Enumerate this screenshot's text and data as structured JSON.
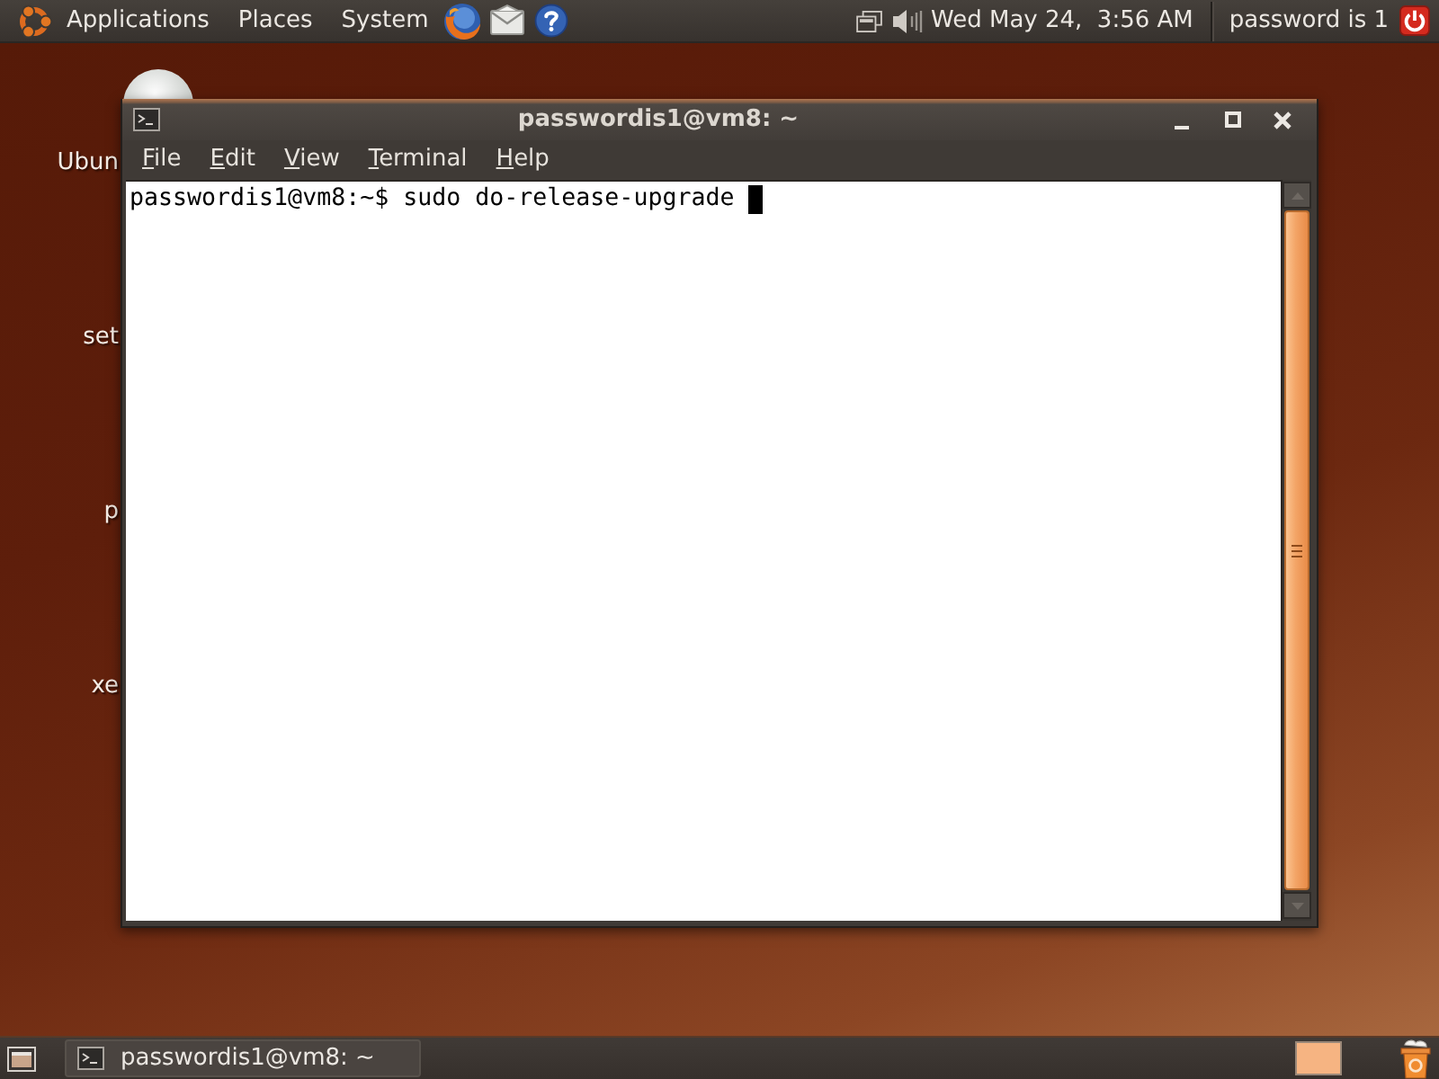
{
  "top_panel": {
    "menus": [
      "Applications",
      "Places",
      "System"
    ],
    "clock": "Wed May 24,  3:56 AM",
    "user": "password is 1"
  },
  "desktop_icons": [
    "Ubun",
    "set",
    "p",
    "xe"
  ],
  "window": {
    "title": "passwordis1@vm8: ~",
    "menu": [
      {
        "label": "File",
        "mnemonic_underlined": true
      },
      {
        "label": "Edit",
        "mnemonic_underlined": true
      },
      {
        "label": "View",
        "mnemonic_underlined": true
      },
      {
        "label": "Terminal",
        "mnemonic_underlined": true
      },
      {
        "label": "Help",
        "mnemonic_underlined": true
      }
    ],
    "terminal_lines": [
      "passwordis1@vm8:~$ sudo do-release-upgrade"
    ]
  },
  "bottom_panel": {
    "tasks": [
      {
        "label": "passwordis1@vm8: ~",
        "selected": true
      }
    ]
  }
}
